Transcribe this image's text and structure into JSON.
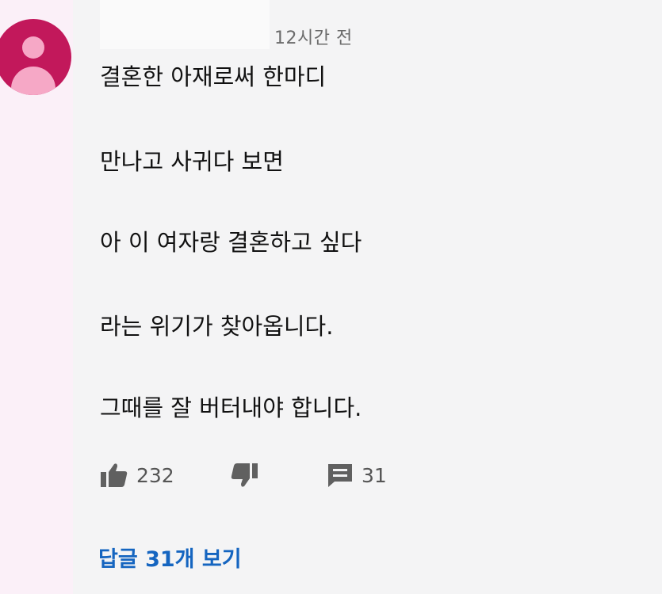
{
  "comment": {
    "timestamp": "12시간 전",
    "lines": [
      "결혼한 아재로써 한마디",
      "만나고 사귀다 보면",
      "아 이 여자랑 결혼하고 싶다",
      "라는 위기가 찾아옵니다.",
      "그때를 잘 버터내야 합니다."
    ]
  },
  "actions": {
    "like_count": "232",
    "reply_count": "31"
  },
  "replies": {
    "view_label": "답글 31개 보기"
  },
  "icons": {
    "avatar": "default-avatar-icon",
    "like": "thumbs-up-icon",
    "dislike": "thumbs-down-icon",
    "reply": "comment-icon"
  },
  "colors": {
    "avatar_bg": "#c2185b",
    "avatar_fg": "#f6a8c6",
    "link": "#1565c0",
    "icon": "#606060"
  }
}
